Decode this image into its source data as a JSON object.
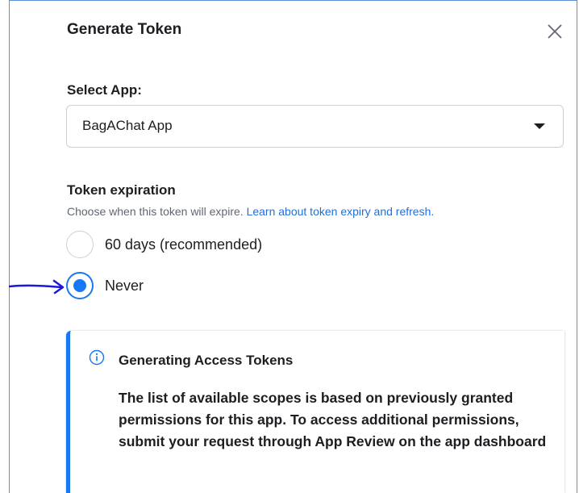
{
  "dialog": {
    "title": "Generate Token",
    "close_icon": "close-icon"
  },
  "select_app": {
    "label": "Select App:",
    "value": "BagAChat App",
    "caret_icon": "caret-down-icon"
  },
  "expiration": {
    "label": "Token expiration",
    "helper_text": "Choose when this token will expire.",
    "helper_link": "Learn about token expiry and refresh.",
    "options": [
      {
        "label": "60 days (recommended)",
        "selected": false
      },
      {
        "label": "Never",
        "selected": true
      }
    ]
  },
  "annotation": {
    "icon": "hand-drawn-arrow-icon",
    "color": "#1a1ad6"
  },
  "info": {
    "icon": "info-icon",
    "title": "Generating Access Tokens",
    "body": "The list of available scopes is based on previously granted permissions for this app. To access additional permissions, submit your request through App Review on the app dashboard"
  },
  "colors": {
    "accent": "#1877f2",
    "link": "#216fdb",
    "frame": "#5b8fd6"
  }
}
